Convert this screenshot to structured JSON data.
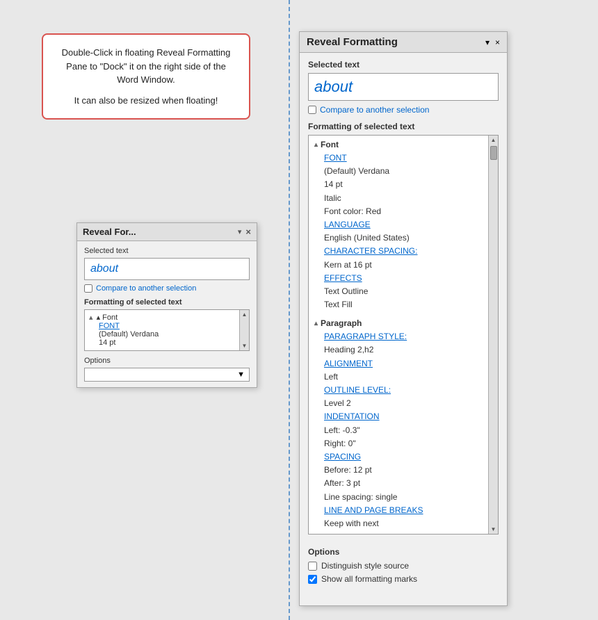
{
  "tooltip": {
    "line1": "Double-Click in floating Reveal Formatting Pane to \"Dock\" it on the right side of the Word Window.",
    "line2": "It can also be resized when floating!"
  },
  "panel_small": {
    "title": "Reveal For...",
    "dropdown_icon": "▾",
    "close_icon": "×",
    "selected_text_label": "Selected text",
    "selected_text_value": "about",
    "compare_label": "Compare to another selection",
    "formatting_label": "Formatting of selected text",
    "font_header": "▴ Font",
    "font_link": "FONT",
    "font_value": "(Default) Verdana",
    "font_pt": "14 pt",
    "options_label": "Options",
    "options_dropdown_icon": "▼"
  },
  "panel_main": {
    "title": "Reveal Formatting",
    "dropdown_icon": "▾",
    "close_icon": "×",
    "selected_text_label": "Selected text",
    "selected_text_value": "about",
    "compare_label": "Compare to another selection",
    "formatting_label": "Formatting of selected text",
    "font_section": {
      "header": "Font",
      "toggle": "▴",
      "link_font": "FONT",
      "font_default": "(Default) Verdana",
      "font_size": "14 pt",
      "font_style": "Italic",
      "font_color": "Font color: Red",
      "link_language": "LANGUAGE",
      "language_value": "English (United States)",
      "link_char_spacing": "CHARACTER SPACING:",
      "char_spacing_value": "Kern at 16 pt",
      "link_effects": "EFFECTS",
      "effects_1": "Text Outline",
      "effects_2": "Text Fill"
    },
    "paragraph_section": {
      "header": "Paragraph",
      "toggle": "▴",
      "link_para_style": "PARAGRAPH STYLE:",
      "para_style_value": "Heading 2,h2",
      "link_alignment": "ALIGNMENT",
      "alignment_value": "Left",
      "link_outline": "OUTLINE LEVEL:",
      "outline_value": "Level 2",
      "link_indentation": "INDENTATION",
      "indent_left": "Left:  -0.3\"",
      "indent_right": "Right:  0\"",
      "link_spacing": "SPACING",
      "spacing_before": "Before:  12 pt",
      "spacing_after": "After:  3 pt",
      "spacing_line": "Line spacing:  single",
      "link_line_breaks": "LINE AND PAGE BREAKS",
      "line_breaks_value": "Keep with next"
    },
    "options": {
      "label": "Options",
      "distinguish_label": "Distinguish style source",
      "show_marks_label": "Show all formatting marks",
      "distinguish_checked": false,
      "show_marks_checked": true
    }
  }
}
